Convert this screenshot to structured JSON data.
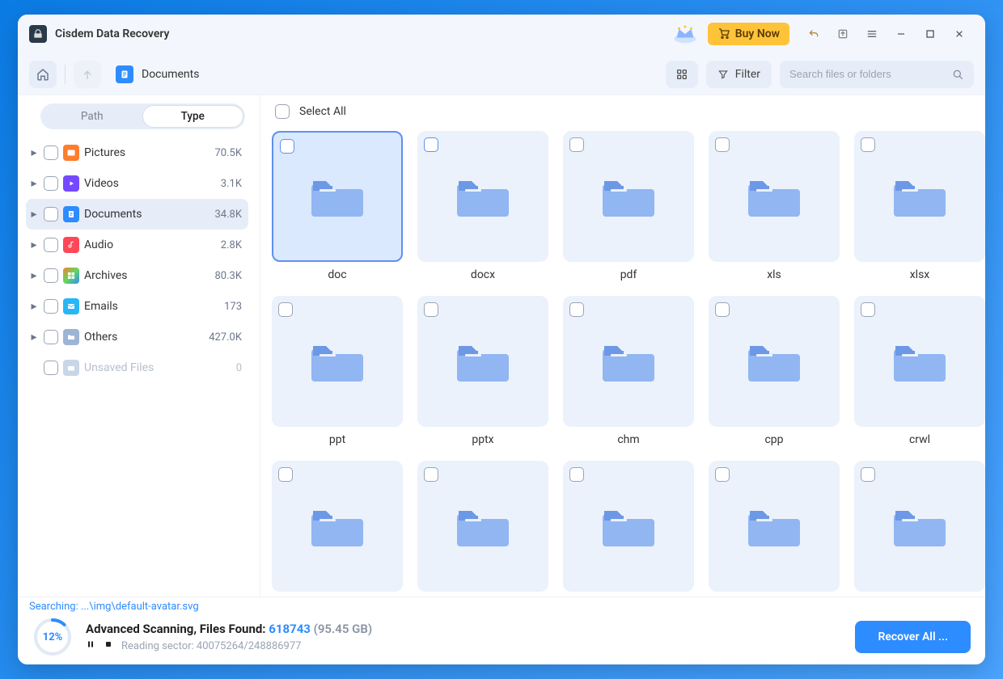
{
  "app": {
    "title": "Cisdem Data Recovery"
  },
  "titlebar": {
    "buy_now": "Buy Now"
  },
  "toolbar": {
    "breadcrumb": "Documents",
    "filter_label": "Filter",
    "search_placeholder": "Search files or folders"
  },
  "sidebar": {
    "tabs": {
      "path": "Path",
      "type": "Type"
    },
    "items": [
      {
        "label": "Pictures",
        "count": "70.5K",
        "color": "c-orange",
        "icon": "image",
        "caret": true
      },
      {
        "label": "Videos",
        "count": "3.1K",
        "color": "c-purple",
        "icon": "play",
        "caret": true
      },
      {
        "label": "Documents",
        "count": "34.8K",
        "color": "c-blue",
        "icon": "doc",
        "caret": true,
        "active": true
      },
      {
        "label": "Audio",
        "count": "2.8K",
        "color": "c-red",
        "icon": "music",
        "caret": true
      },
      {
        "label": "Archives",
        "count": "80.3K",
        "color": "c-multi",
        "icon": "grid",
        "caret": true
      },
      {
        "label": "Emails",
        "count": "173",
        "color": "c-cyan",
        "icon": "mail",
        "caret": true
      },
      {
        "label": "Others",
        "count": "427.0K",
        "color": "c-gray",
        "icon": "folder",
        "caret": true
      },
      {
        "label": "Unsaved Files",
        "count": "0",
        "color": "c-gray2",
        "icon": "camera",
        "caret": false,
        "disabled": true
      }
    ]
  },
  "main": {
    "select_all": "Select All",
    "folders": [
      "doc",
      "docx",
      "pdf",
      "xls",
      "xlsx",
      "ppt",
      "pptx",
      "chm",
      "cpp",
      "crwl",
      "",
      "",
      "",
      "",
      ""
    ],
    "selected_index": 0
  },
  "status": {
    "current_prefix": "Searching: ",
    "current_path": "...\\img\\default-avatar.svg",
    "progress_pct": "12%",
    "line1_prefix": "Advanced Scanning, Files Found: ",
    "files_found": "618743",
    "total_size": " (95.45 GB)",
    "line2_prefix": "Reading sector: ",
    "sector": "40075264/248886977",
    "recover_label": "Recover All ..."
  }
}
